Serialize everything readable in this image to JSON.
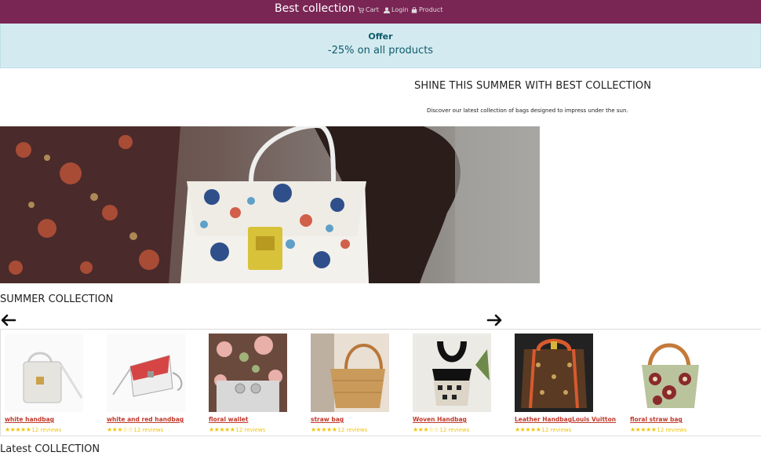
{
  "navbar": {
    "brand": "Best collection",
    "links": {
      "cart": "Cart",
      "login": "Login",
      "product": "Product"
    }
  },
  "offer": {
    "title": "Offer",
    "text": "-25% on all products"
  },
  "hero": {
    "title": "SHINE THIS SUMMER WITH BEST COLLECTION",
    "subtitle": "Discover our latest collection of bags designed to impress under the sun."
  },
  "sections": {
    "summer": "SUMMER COLLECTION",
    "latest": "Latest COLLECTION"
  },
  "products": [
    {
      "name": "white handbag",
      "stars": "★★★★★",
      "rating": 5,
      "reviews": "12 reviews"
    },
    {
      "name": "white and red handbag",
      "stars": "★★★☆☆",
      "rating": 3,
      "reviews": "12 reviews"
    },
    {
      "name": "floral wallet",
      "stars": "★★★★★",
      "rating": 5,
      "reviews": "12 reviews"
    },
    {
      "name": "straw bag",
      "stars": "★★★★★",
      "rating": 5,
      "reviews": "12 reviews"
    },
    {
      "name": "Woven Handbag",
      "stars": "★★★☆☆",
      "rating": 3,
      "reviews": "12 reviews"
    },
    {
      "name": "Leather HandbagLouis Vuitton",
      "stars": "★★★★★",
      "rating": 5,
      "reviews": "12 reviews"
    },
    {
      "name": "floral straw bag",
      "stars": "★★★★★",
      "rating": 5,
      "reviews": "12 reviews"
    }
  ],
  "colors": {
    "brand": "#7a2655",
    "offer_bg": "#d3ebf0",
    "offer_text": "#0f5a6a",
    "link": "#c0392b",
    "star": "#f1c40f"
  },
  "icons": {
    "cart": "cart-icon",
    "login": "user-icon",
    "product": "bag-icon",
    "prev": "arrow-left-icon",
    "next": "arrow-right-icon"
  }
}
